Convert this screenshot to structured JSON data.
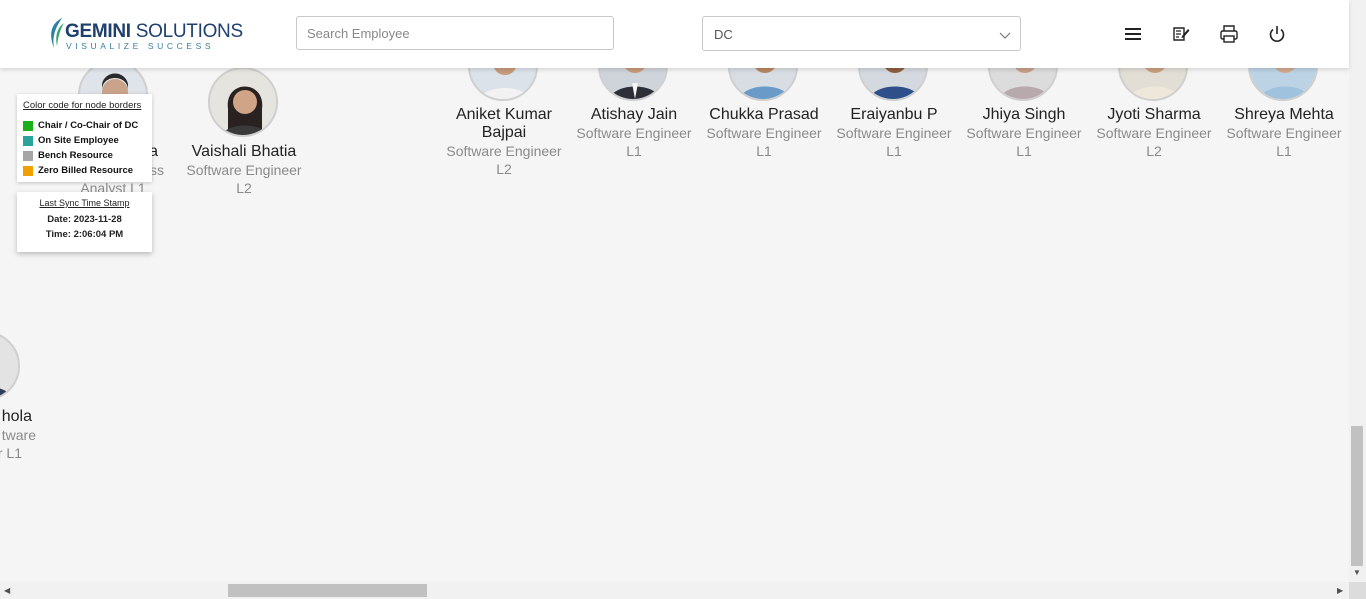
{
  "header": {
    "logo_main_bold": "GEMINI",
    "logo_main_rest": " SOLUTIONS",
    "logo_tagline": "VISUALIZE SUCCESS",
    "search_placeholder": "Search Employee",
    "dc_value": "DC",
    "icons": [
      "menu-icon",
      "notes-icon",
      "printer-icon",
      "power-icon"
    ]
  },
  "legend": {
    "title": "Color code for node borders",
    "items": [
      {
        "label": "Chair / Co-Chair of DC",
        "color": "#19b019"
      },
      {
        "label": "On Site Employee",
        "color": "#2aa39a"
      },
      {
        "label": "Bench Resource",
        "color": "#a6a6a6"
      },
      {
        "label": "Zero Billed Resource",
        "color": "#f0a000"
      }
    ]
  },
  "sync": {
    "title": "Last Sync Time Stamp",
    "date": "Date: 2023-11-28",
    "time": "Time: 2:06:04 PM"
  },
  "nodes": [
    {
      "name": "a",
      "role": "ss",
      "level": "Analyst L1"
    },
    {
      "name": "Vaishali Bhatia",
      "role": "Software Engineer",
      "level": "L2"
    },
    {
      "name": "Aniket Kumar Bajpai",
      "role": "Software Engineer",
      "level": "L2"
    },
    {
      "name": "Atishay Jain",
      "role": "Software Engineer",
      "level": "L1"
    },
    {
      "name": "Chukka Prasad",
      "role": "Software Engineer",
      "level": "L1"
    },
    {
      "name": "Eraiyanbu P",
      "role": "Software Engineer",
      "level": "L1"
    },
    {
      "name": "Jhiya Singh",
      "role": "Software Engineer",
      "level": "L1"
    },
    {
      "name": "Jyoti Sharma",
      "role": "Software Engineer",
      "level": "L2"
    },
    {
      "name": "Shreya Mehta",
      "role": "Software Engineer",
      "level": "L1"
    },
    {
      "name": "hola",
      "role": "tware",
      "level": "r L1"
    }
  ]
}
